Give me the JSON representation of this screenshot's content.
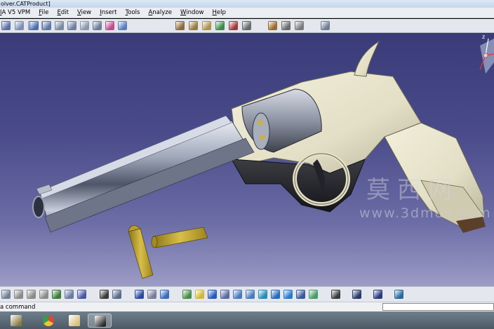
{
  "window": {
    "title": "olver.CATProduct]"
  },
  "menu": {
    "items": [
      {
        "label": "IA V5 VPM",
        "name": "menu-app"
      },
      {
        "label": "File",
        "name": "menu-file"
      },
      {
        "label": "Edit",
        "name": "menu-edit"
      },
      {
        "label": "View",
        "name": "menu-view"
      },
      {
        "label": "Insert",
        "name": "menu-insert"
      },
      {
        "label": "Tools",
        "name": "menu-tools"
      },
      {
        "label": "Analyze",
        "name": "menu-analyze"
      },
      {
        "label": "Window",
        "name": "menu-window"
      },
      {
        "label": "Help",
        "name": "menu-help"
      }
    ]
  },
  "top_toolbar": {
    "icons": [
      {
        "name": "new-icon",
        "color": "#5a6fa8"
      },
      {
        "name": "open-icon",
        "color": "#7d8db5"
      },
      {
        "name": "save-icon",
        "color": "#7e8fa6"
      },
      {
        "name": "print-icon",
        "color": "#8a96a6"
      },
      {
        "name": "catalog-icon",
        "color": "#9aa6b4"
      },
      {
        "name": "fly-mode-icon",
        "color": "#4a6fb1"
      },
      {
        "name": "fit-all-icon",
        "color": "#5d78a6"
      },
      {
        "name": "pan-icon",
        "color": "#7a8aa0"
      },
      {
        "name": "rotate-icon",
        "color": "#6e7fa0"
      },
      {
        "name": "zoom-in-icon",
        "color": "#8898b0"
      },
      {
        "name": "normal-view-icon",
        "color": "#6b7d98"
      },
      {
        "name": "multi-view-icon",
        "color": "#c34a8c"
      },
      {
        "name": "quick-view-icon",
        "color": "#5a7dbf"
      },
      {
        "name": "product-structure-icon",
        "color": "#8c6a3a"
      },
      {
        "name": "constraint-icon",
        "color": "#9a7a3c"
      },
      {
        "name": "assembly-icon",
        "color": "#b0924a"
      },
      {
        "name": "manipulation-icon",
        "color": "#3d8a4b"
      },
      {
        "name": "snap-icon",
        "color": "#a03a3a"
      },
      {
        "name": "explode-icon",
        "color": "#6a6a6a"
      },
      {
        "name": "clash-icon",
        "color": "#9a6a2a"
      },
      {
        "name": "sectioning-icon",
        "color": "#6c6c6c"
      },
      {
        "name": "measure-icon",
        "color": "#7b7b7b"
      },
      {
        "name": "compass-icon",
        "color": "#6f7f94"
      }
    ]
  },
  "bottom_toolbar": {
    "icons": [
      {
        "name": "sketch-icon",
        "color": "#6f7f94"
      },
      {
        "name": "cut-icon",
        "color": "#8a8a8a"
      },
      {
        "name": "copy-icon",
        "color": "#8a8a8a"
      },
      {
        "name": "paste-icon",
        "color": "#8a8a8a"
      },
      {
        "name": "undo-icon",
        "color": "#3b7a3b"
      },
      {
        "name": "redo-icon",
        "color": "#6a7aa0"
      },
      {
        "name": "what-is-this-icon",
        "color": "#4a5aa0"
      },
      {
        "name": "formula-icon",
        "color": "#3a3a3a"
      },
      {
        "name": "comment-icon",
        "color": "#5a6a8a"
      },
      {
        "name": "graph-tree-icon",
        "color": "#2a4a9a"
      },
      {
        "name": "link-icon",
        "color": "#7a7a9a"
      },
      {
        "name": "hide-show-icon",
        "color": "#3a6ab8"
      },
      {
        "name": "fly-icon",
        "color": "#4a8a4a"
      },
      {
        "name": "fit-in-icon",
        "color": "#d0b83a"
      },
      {
        "name": "pan-view-icon",
        "color": "#2a5ab8"
      },
      {
        "name": "rotate-view-icon",
        "color": "#5a6aa0"
      },
      {
        "name": "zoom-in-view-icon",
        "color": "#4a7aba"
      },
      {
        "name": "zoom-out-view-icon",
        "color": "#4a7aba"
      },
      {
        "name": "normal-to-icon",
        "color": "#2a8ab8"
      },
      {
        "name": "iso-view-icon",
        "color": "#2a6ab8"
      },
      {
        "name": "shading-icon",
        "color": "#2a7acb"
      },
      {
        "name": "hide-icon",
        "color": "#3a5a9a"
      },
      {
        "name": "swap-space-icon",
        "color": "#4a9a6a"
      },
      {
        "name": "camera-icon",
        "color": "#3a3a3a"
      },
      {
        "name": "spin-icon",
        "color": "#2a3a6a"
      },
      {
        "name": "table-icon",
        "color": "#2a3a7a"
      },
      {
        "name": "bar-chart-icon",
        "color": "#2a6a9a"
      }
    ]
  },
  "status": {
    "text": "a command",
    "command_value": ""
  },
  "taskbar": {
    "items": [
      {
        "name": "taskbar-media-player-icon",
        "color": "#8a7a3a"
      },
      {
        "name": "taskbar-chrome-icon",
        "color": "#d64a3a"
      },
      {
        "name": "taskbar-explorer-icon",
        "color": "#d8c07a"
      },
      {
        "name": "taskbar-catia-icon",
        "color": "#2a2a2a"
      }
    ]
  },
  "watermark": {
    "logo": "莫西网",
    "url": "www.3dmox.com"
  },
  "compass": {
    "axis_label": "z"
  },
  "colors": {
    "viewport_top": "#3a3b79",
    "viewport_bottom": "#9c9cc6",
    "frame_color": "#e3dfc6",
    "barrel_color": "#9ea6b8",
    "cartridge_color": "#b59b2a"
  }
}
